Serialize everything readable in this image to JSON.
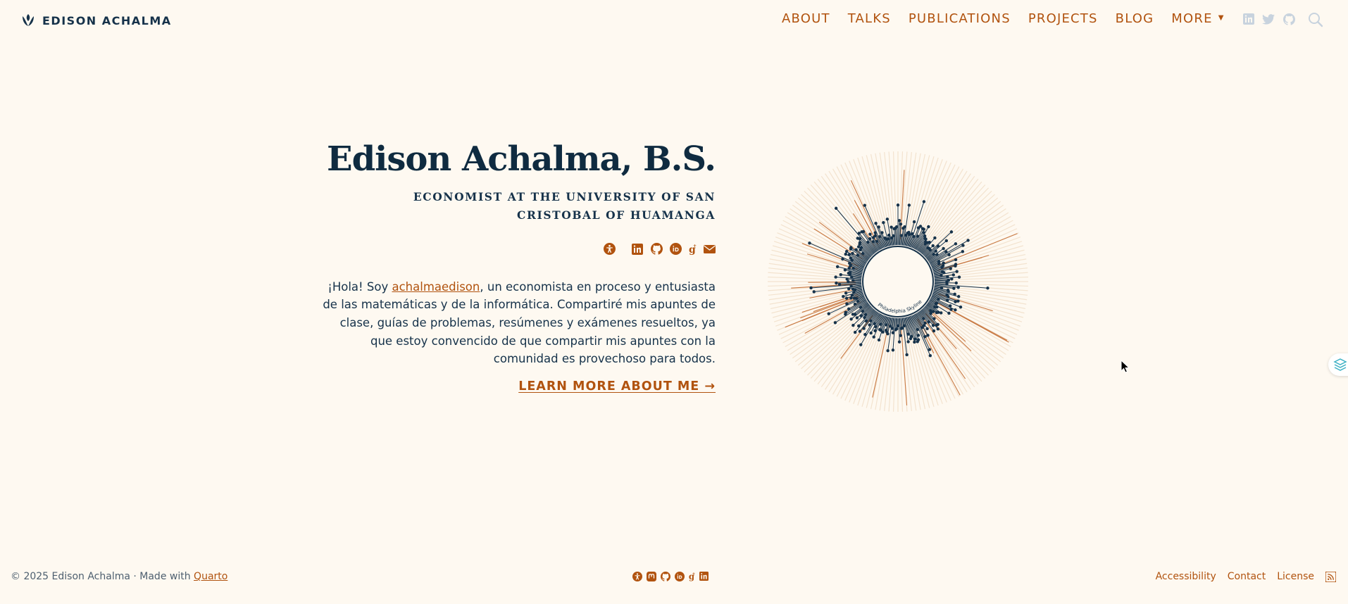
{
  "navbar": {
    "brand": "EDISON ACHALMA",
    "links": [
      {
        "label": "ABOUT"
      },
      {
        "label": "TALKS"
      },
      {
        "label": "PUBLICATIONS"
      },
      {
        "label": "PROJECTS"
      },
      {
        "label": "BLOG"
      },
      {
        "label": "MORE"
      }
    ],
    "icons": [
      "linkedin-icon",
      "twitter-icon",
      "github-icon",
      "search-icon"
    ]
  },
  "hero": {
    "title": "Edison Achalma, B.S.",
    "subtitle": "ECONOMIST AT THE UNIVERSITY OF SAN CRISTOBAL OF HUAMANGA",
    "social_icons": [
      "accessibility-icon",
      "linkedin-icon",
      "github-icon",
      "orcid-icon",
      "google-scholar-icon",
      "envelope-icon"
    ],
    "bio_before": "¡Hola! Soy ",
    "bio_link": "achalmaedison",
    "bio_after": ", un economista en proceso y entusiasta de las matemáticas y de la informática. Compartiré mis apuntes de clase, guías de problemas, resúmenes y exámenes resueltos, ya que estoy convencido de que compartir mis apuntes con la comunidad es provechoso para todos.",
    "cta": "LEARN MORE ABOUT ME →",
    "image_caption": "Philadelphia Skyline"
  },
  "footer": {
    "copyright": "© 2025 Edison Achalma · Made with ",
    "quarto": "Quarto",
    "social_icons": [
      "accessibility-icon",
      "mastodon-icon",
      "github-icon",
      "orcid-icon",
      "google-scholar-icon",
      "linkedin-icon"
    ],
    "links": [
      {
        "label": "Accessibility"
      },
      {
        "label": "Contact"
      },
      {
        "label": "License"
      }
    ]
  },
  "colors": {
    "background": "#fef9f1",
    "navy": "#16324a",
    "accent": "#b1530f",
    "muted_icon": "#c8d3de"
  }
}
